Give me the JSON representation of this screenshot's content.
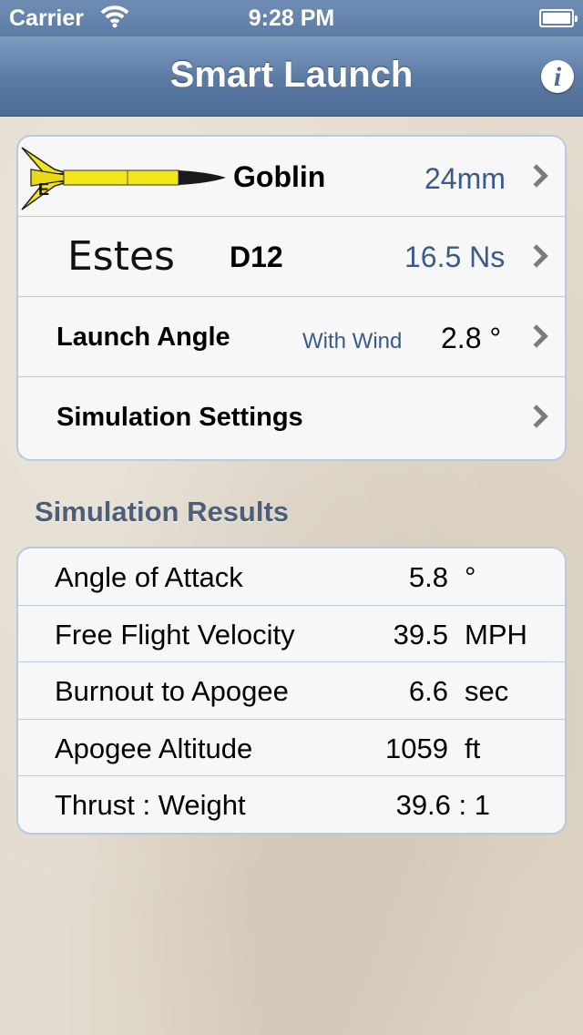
{
  "status_bar": {
    "carrier": "Carrier",
    "time": "9:28 PM"
  },
  "nav": {
    "title": "Smart Launch",
    "info_label": "i"
  },
  "rocket": {
    "name": "Goblin",
    "diameter": "24mm"
  },
  "motor": {
    "manufacturer": "Estes",
    "designation": "D12",
    "impulse": "16.5 Ns"
  },
  "launch": {
    "label": "Launch Angle",
    "mode": "With Wind",
    "value": "2.8 °"
  },
  "sim_settings": {
    "label": "Simulation Settings"
  },
  "results": {
    "header": "Simulation Results",
    "rows": [
      {
        "label": "Angle of Attack",
        "value": "5.8",
        "unit": "°"
      },
      {
        "label": "Free Flight Velocity",
        "value": "39.5",
        "unit": "MPH"
      },
      {
        "label": "Burnout to Apogee",
        "value": "6.6",
        "unit": "sec"
      },
      {
        "label": "Apogee Altitude",
        "value": "1059",
        "unit": "ft"
      },
      {
        "label": "Thrust : Weight",
        "value": "39.6 : 1",
        "unit": ""
      }
    ]
  },
  "colors": {
    "nav_bar": "#5b7aa4",
    "accent_blue_text": "#3a5a8c",
    "group_border": "#b6cbe0",
    "background": "#e3dbcd",
    "rocket_body": "#f2e51c"
  },
  "icons": [
    "wifi-icon",
    "battery-icon",
    "info-icon",
    "chevron-right-icon",
    "rocket-image"
  ]
}
